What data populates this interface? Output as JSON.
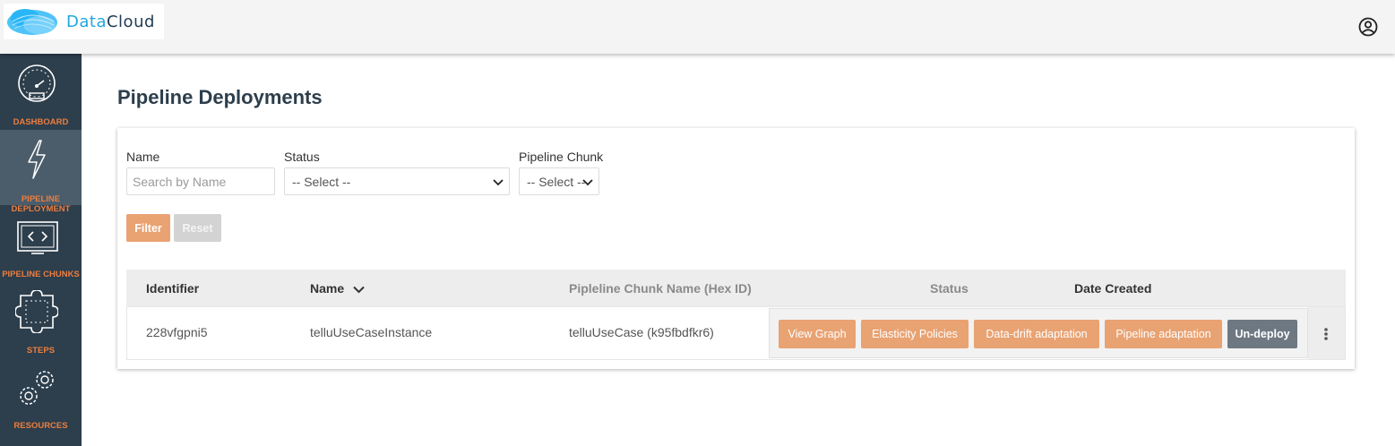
{
  "app": {
    "logo_text_a": "Data",
    "logo_text_b": "Cloud"
  },
  "sidebar": {
    "items": [
      {
        "label": "DASHBOARD",
        "icon": "gauge-icon"
      },
      {
        "label_line1": "PIPELINE",
        "label_line2": "DEPLOYMENT",
        "icon": "lightning-icon",
        "active": true
      },
      {
        "label": "PIPELINE CHUNKS",
        "icon": "code-window-icon"
      },
      {
        "label": "STEPS",
        "icon": "puzzle-icon"
      },
      {
        "label": "RESOURCES",
        "icon": "gears-icon"
      }
    ]
  },
  "page": {
    "title": "Pipeline Deployments"
  },
  "filters": {
    "name_label": "Name",
    "name_placeholder": "Search by Name",
    "status_label": "Status",
    "status_value": "-- Select --",
    "chunk_label": "Pipeline Chunk",
    "chunk_value": "-- Select --",
    "filter_button": "Filter",
    "reset_button": "Reset"
  },
  "table": {
    "columns": {
      "identifier": "Identifier",
      "name": "Name",
      "chunk": "Pipleline Chunk Name (Hex ID)",
      "status": "Status",
      "date": "Date Created"
    },
    "rows": [
      {
        "identifier": "228vfgpni5",
        "name": "telluUseCaseInstance",
        "chunk": "telluUseCase (k95fbdfkr6)",
        "status": "",
        "date": "",
        "actions": {
          "view_graph": "View Graph",
          "elasticity": "Elasticity Policies",
          "data_drift": "Data-drift adaptation",
          "pipeline_adaptation": "Pipeline adaptation",
          "undeploy": "Un-deploy"
        }
      }
    ]
  },
  "colors": {
    "accent": "#ec7e3f",
    "sidebar_bg": "#2d3e4c",
    "button_orange": "#e9a272",
    "button_dark": "#6d7883"
  }
}
